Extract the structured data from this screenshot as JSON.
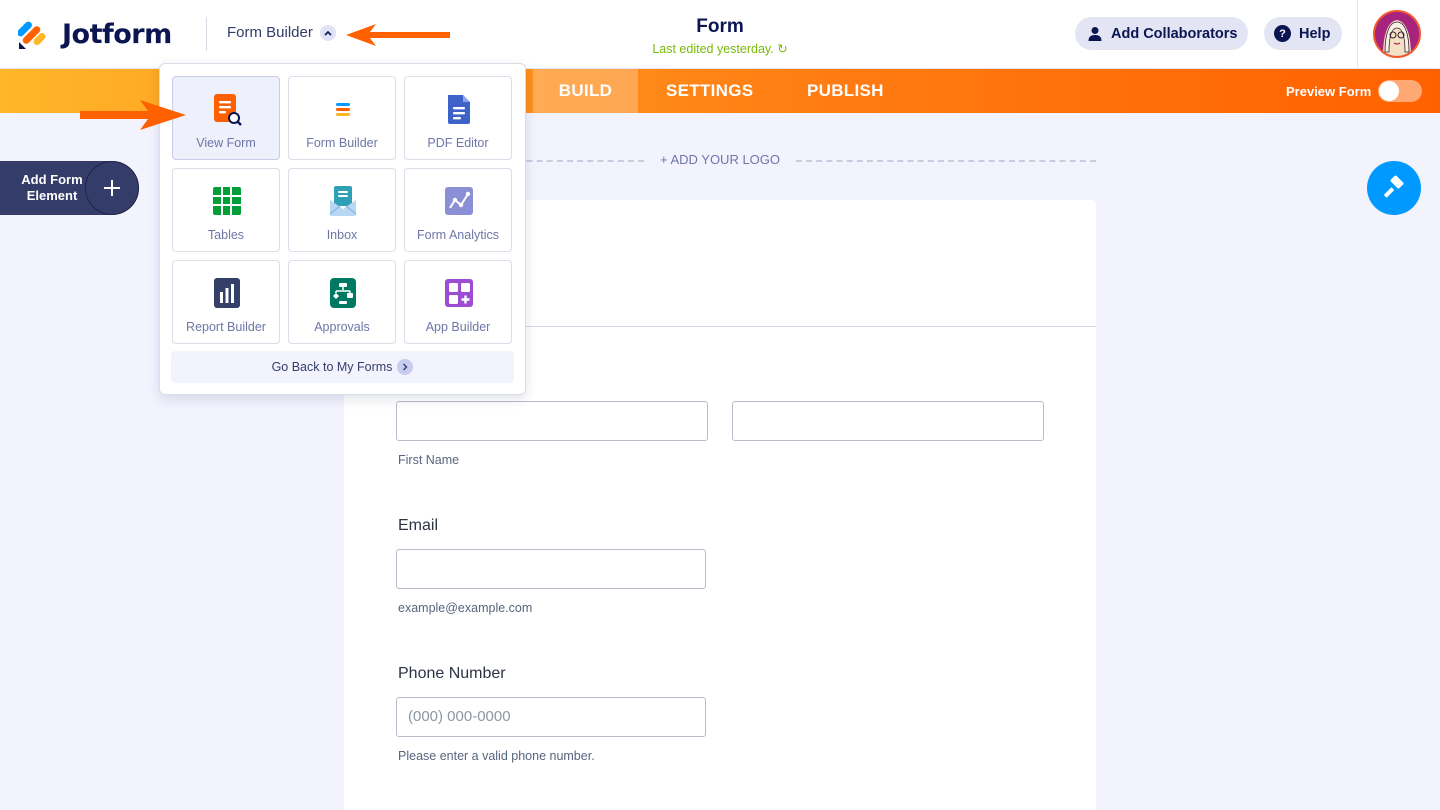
{
  "header": {
    "logo_text": "Jotform",
    "builder_switch_label": "Form Builder",
    "form_title": "Form",
    "last_edited": "Last edited yesterday.",
    "collaborators_label": "Add Collaborators",
    "help_label": "Help"
  },
  "nav": {
    "tabs": [
      {
        "label": "BUILD",
        "active": true
      },
      {
        "label": "SETTINGS",
        "active": false
      },
      {
        "label": "PUBLISH",
        "active": false
      }
    ],
    "preview_label": "Preview Form",
    "preview_on": false
  },
  "sidebar": {
    "add_element_label": "Add Form Element"
  },
  "form": {
    "add_logo": "+ ADD YOUR LOGO",
    "first_name_sublabel": "First Name",
    "email_label": "Email",
    "email_sublabel": "example@example.com",
    "phone_label": "Phone Number",
    "phone_placeholder": "(000) 000-0000",
    "phone_sublabel": "Please enter a valid phone number."
  },
  "app_menu": {
    "items": [
      {
        "label": "View Form",
        "icon": "view-form-icon",
        "color": "#ff6100",
        "active": true
      },
      {
        "label": "Form Builder",
        "icon": "form-builder-icon",
        "color": "#0099ff",
        "active": false
      },
      {
        "label": "PDF Editor",
        "icon": "pdf-editor-icon",
        "color": "#3e62c8",
        "active": false
      },
      {
        "label": "Tables",
        "icon": "tables-icon",
        "color": "#049e38",
        "active": false
      },
      {
        "label": "Inbox",
        "icon": "inbox-icon",
        "color": "#2fa0b5",
        "active": false
      },
      {
        "label": "Form Analytics",
        "icon": "form-analytics-icon",
        "color": "#8a8fd6",
        "active": false
      },
      {
        "label": "Report Builder",
        "icon": "report-builder-icon",
        "color": "#344067",
        "active": false
      },
      {
        "label": "Approvals",
        "icon": "approvals-icon",
        "color": "#007862",
        "active": false
      },
      {
        "label": "App Builder",
        "icon": "app-builder-icon",
        "color": "#9c4dd3",
        "active": false
      }
    ],
    "go_back_label": "Go Back to My Forms"
  },
  "colors": {
    "brand_navy": "#0a1551",
    "brand_orange": "#ff6100",
    "edited_green": "#78bb07",
    "designer_blue": "#0099ff"
  }
}
